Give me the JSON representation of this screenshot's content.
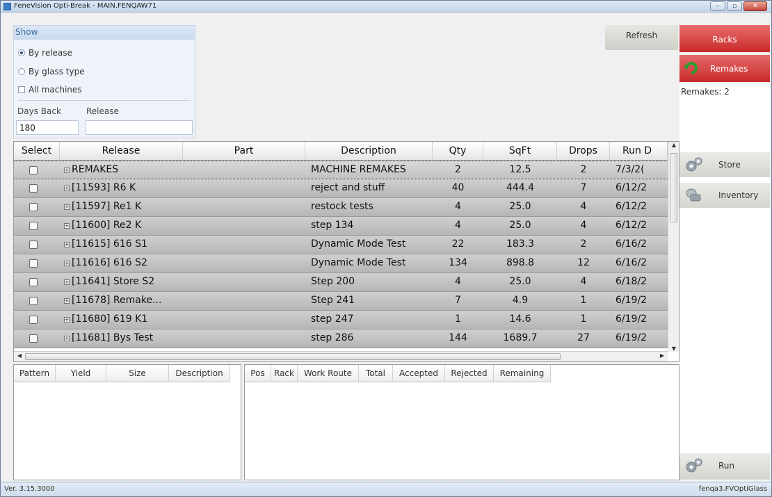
{
  "window": {
    "title": "FeneVision Opti-Break - MAIN.FENQAW71",
    "controls": [
      "–",
      "▫",
      "✕"
    ]
  },
  "show_panel": {
    "header": "Show",
    "by_release": "By release",
    "by_glass_type": "By glass type",
    "all_machines": "All machines",
    "days_back_label": "Days Back",
    "days_back_value": "180",
    "release_label": "Release",
    "release_value": ""
  },
  "buttons": {
    "refresh": "Refresh",
    "racks": "Racks",
    "remakes": "Remakes",
    "store": "Store",
    "inventory": "Inventory",
    "run": "Run"
  },
  "remakes_count": "Remakes: 2",
  "grid": {
    "columns": [
      "Select",
      "Release",
      "Part",
      "Description",
      "Qty",
      "SqFt",
      "Drops",
      "Run D"
    ],
    "rows": [
      {
        "release": "REMAKES",
        "description": "MACHINE REMAKES",
        "qty": "2",
        "sqft": "12.5",
        "drops": "2",
        "run": "7/3/2("
      },
      {
        "release": "[11593] R6 K",
        "description": "reject and stuff",
        "qty": "40",
        "sqft": "444.4",
        "drops": "7",
        "run": "6/12/2"
      },
      {
        "release": "[11597] Re1 K",
        "description": "restock tests",
        "qty": "4",
        "sqft": "25.0",
        "drops": "4",
        "run": "6/12/2"
      },
      {
        "release": "[11600] Re2 K",
        "description": "step 134",
        "qty": "4",
        "sqft": "25.0",
        "drops": "4",
        "run": "6/12/2"
      },
      {
        "release": "[11615] 616 S1",
        "description": "Dynamic Mode Test",
        "qty": "22",
        "sqft": "183.3",
        "drops": "2",
        "run": "6/16/2"
      },
      {
        "release": "[11616] 616 S2",
        "description": "Dynamic Mode Test",
        "qty": "134",
        "sqft": "898.8",
        "drops": "12",
        "run": "6/16/2"
      },
      {
        "release": "[11641] Store S2",
        "description": "Step 200",
        "qty": "4",
        "sqft": "25.0",
        "drops": "4",
        "run": "6/18/2"
      },
      {
        "release": "[11678]  Remake...",
        "description": "Step 241",
        "qty": "7",
        "sqft": "4.9",
        "drops": "1",
        "run": "6/19/2"
      },
      {
        "release": "[11680] 619 K1",
        "description": "step 247",
        "qty": "1",
        "sqft": "14.6",
        "drops": "1",
        "run": "6/19/2"
      },
      {
        "release": "[11681] Bys Test",
        "description": "step 286",
        "qty": "144",
        "sqft": "1689.7",
        "drops": "27",
        "run": "6/19/2"
      }
    ]
  },
  "pattern_grid": {
    "columns": [
      "Pattern",
      "Yield",
      "Size",
      "Description"
    ]
  },
  "rack_grid": {
    "columns": [
      "Pos",
      "Rack",
      "Work Route",
      "Total",
      "Accepted",
      "Rejected",
      "Remaining"
    ]
  },
  "status": {
    "version": "Ver. 3.15.3000",
    "user": "fenqa3.FVOptiGlass"
  }
}
